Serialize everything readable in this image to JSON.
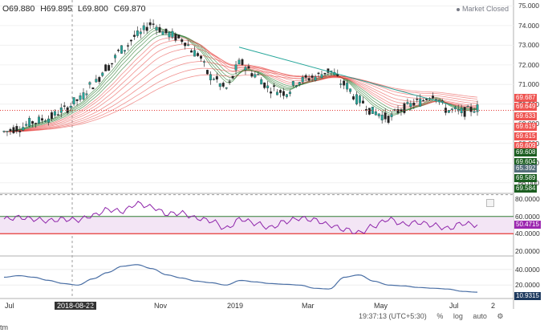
{
  "header": {
    "open": "O69.880",
    "high": "H69.895",
    "low": "L69.800",
    "close": "C69.870",
    "market_status": "Market Closed"
  },
  "price_axis": [
    "75.000",
    "74.000",
    "73.000",
    "72.000",
    "71.000",
    "70.000",
    "69.000",
    "68.000",
    "67.000",
    "66.000"
  ],
  "price_tags": [
    {
      "text": "69.687",
      "color": "#ef5350"
    },
    {
      "text": "69.649",
      "color": "#ef5350"
    },
    {
      "text": "69.633",
      "color": "#ef5350"
    },
    {
      "text": "69.619",
      "color": "#ef5350"
    },
    {
      "text": "69.615",
      "color": "#ef5350"
    },
    {
      "text": "69.609",
      "color": "#ef5350"
    },
    {
      "text": "69.608",
      "color": "#1b5e20"
    },
    {
      "text": "69.604",
      "color": "#1b5e20"
    },
    {
      "text": "65.392",
      "color": "#546e7a"
    },
    {
      "text": "69.589",
      "color": "#1b5e20"
    },
    {
      "text": "69.584",
      "color": "#1b5e20"
    }
  ],
  "rsi": {
    "axis": [
      "80.0000",
      "60.0000",
      "40.0000",
      "20.0000"
    ],
    "value": "50.4715",
    "value_color": "#9c27b0",
    "upper": 60,
    "lower": 40
  },
  "lower_pane": {
    "axis": [
      "40.0000",
      "20.0000"
    ],
    "value": "10.9315",
    "value_color": "#1e3a5f"
  },
  "time_axis": [
    "Jul",
    "2018-08-22",
    "o",
    "Nov",
    "2019",
    "Mar",
    "May",
    "Jul",
    "2"
  ],
  "footer": {
    "time": "19:37:13 (UTC+5:30)",
    "pct": "%",
    "log": "log",
    "auto": "auto"
  },
  "footer_left": "tm",
  "colors": {
    "trend_line": "#26a69a",
    "candle_up": "#26a69a",
    "candle_down": "#222222",
    "ema_red": "#e53935",
    "ema_green": "#2e7d32",
    "rsi": "#8e24aa",
    "rsi_band": "#f3e5f5",
    "lower_line": "#4a6fa5",
    "price_line": "#e53935"
  },
  "chart_data": {
    "type": "line",
    "title": "",
    "xlabel": "",
    "ylabel": "",
    "ylim": [
      65.5,
      75.3
    ],
    "series": [
      {
        "values": [
          68.6,
          68.8,
          69.1,
          69.3,
          69.7,
          70.2,
          71.0,
          71.9,
          72.8,
          73.5,
          74.1,
          73.6,
          73.3,
          72.6,
          71.4,
          70.8,
          72.1,
          71.5,
          70.8,
          70.6,
          71.2,
          71.4,
          71.7,
          71.0,
          70.2,
          69.6,
          69.3,
          69.8,
          70.1,
          70.5,
          69.7,
          69.6,
          69.8
        ]
      }
    ],
    "rsi": {
      "values": [
        57,
        59,
        57,
        55,
        57,
        56,
        61,
        68,
        66,
        75,
        71,
        63,
        64,
        58,
        55,
        46,
        57,
        52,
        47,
        54,
        58,
        56,
        50,
        45,
        41,
        49,
        57,
        51,
        53,
        50,
        46,
        52,
        50
      ]
    },
    "lower": {
      "values": [
        30,
        32,
        30,
        26,
        22,
        20,
        28,
        36,
        44,
        46,
        41,
        33,
        29,
        25,
        23,
        20,
        26,
        24,
        22,
        21,
        20,
        16,
        15,
        30,
        33,
        25,
        20,
        19,
        17,
        16,
        15,
        12,
        11
      ]
    }
  }
}
